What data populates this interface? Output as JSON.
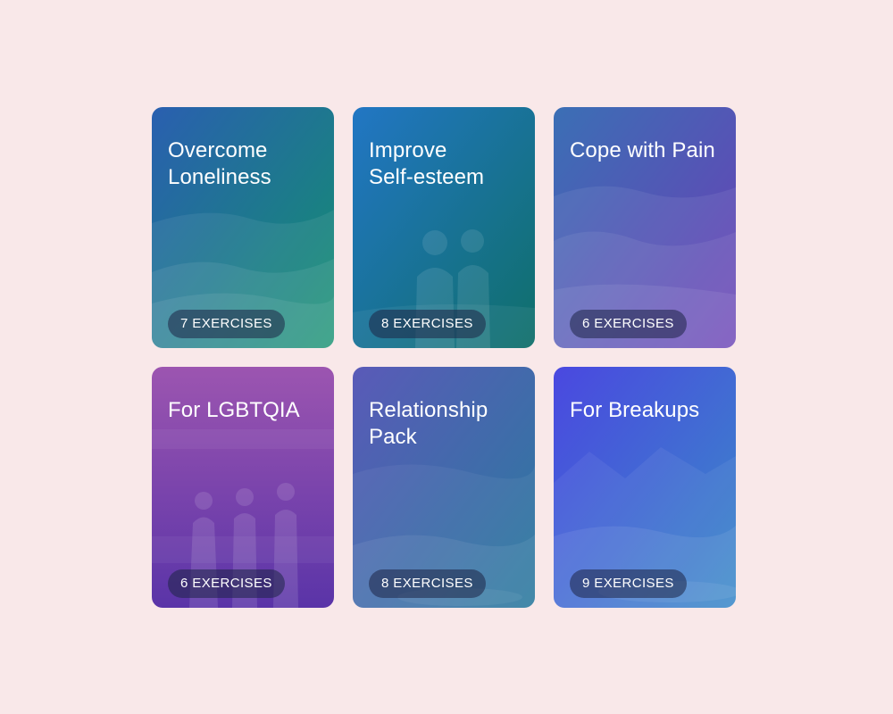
{
  "cards": [
    {
      "title": "Overcome\nLoneliness",
      "count": "7 EXERCISES",
      "grad_from": "#2a5fb0",
      "grad_to": "#12906e"
    },
    {
      "title": "Improve\nSelf-esteem",
      "count": "8 EXERCISES",
      "grad_from": "#2276c4",
      "grad_to": "#0f6f6a"
    },
    {
      "title": "Cope with Pain",
      "count": "6 EXERCISES",
      "grad_from": "#3b6fb5",
      "grad_to": "#6a3fb5"
    },
    {
      "title": "For LGBTQIA",
      "count": "6 EXERCISES",
      "grad_from": "#9c55b0",
      "grad_to": "#5a34a8"
    },
    {
      "title": "Relationship\nPack",
      "count": "8 EXERCISES",
      "grad_from": "#5a5ab8",
      "grad_to": "#2a7a9e"
    },
    {
      "title": "For Breakups",
      "count": "9 EXERCISES",
      "grad_from": "#4a48e0",
      "grad_to": "#3a8ac8"
    }
  ]
}
